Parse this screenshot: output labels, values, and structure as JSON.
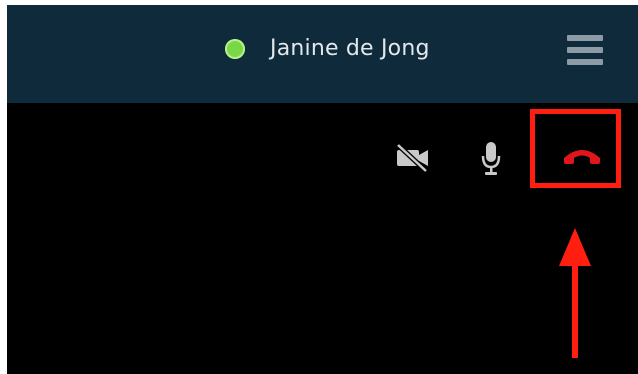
{
  "header": {
    "contact_name": "Janine de Jong",
    "status": "online",
    "status_color": "#7ad848",
    "background_color": "#0f2a3a"
  },
  "menu": {
    "icon": "hamburger-menu-icon"
  },
  "controls": {
    "video": {
      "icon": "video-off-icon",
      "state": "off"
    },
    "mic": {
      "icon": "microphone-icon",
      "state": "on"
    },
    "hangup": {
      "icon": "phone-hangup-icon",
      "color": "#e0161a"
    }
  },
  "annotation": {
    "highlight_color": "#ff1e10",
    "target": "hangup-button"
  }
}
